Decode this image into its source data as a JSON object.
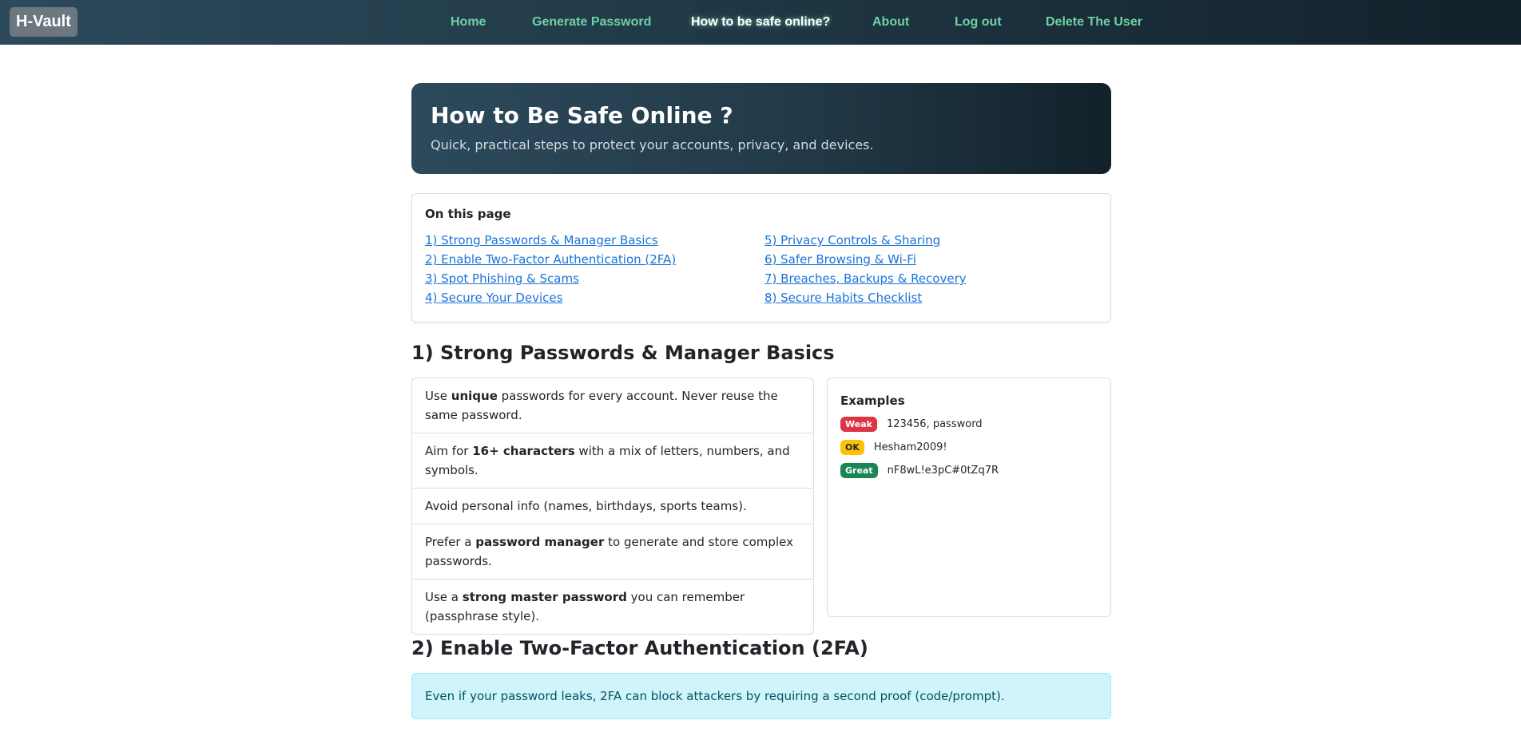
{
  "navbar": {
    "brand": "H-Vault",
    "links": [
      {
        "label": "Home"
      },
      {
        "label": "Generate Password"
      },
      {
        "label": "How to be safe online?",
        "active": true
      },
      {
        "label": "About"
      },
      {
        "label": "Log out"
      },
      {
        "label": "Delete The User"
      }
    ]
  },
  "hero": {
    "title": "How to Be Safe Online ?",
    "subtitle": "Quick, practical steps to protect your accounts, privacy, and devices."
  },
  "toc": {
    "title": "On this page",
    "left": [
      "1) Strong Passwords & Manager Basics",
      "2) Enable Two-Factor Authentication (2FA)",
      "3) Spot Phishing & Scams",
      "4) Secure Your Devices"
    ],
    "right": [
      "5) Privacy Controls & Sharing",
      "6) Safer Browsing & Wi-Fi",
      "7) Breaches, Backups & Recovery",
      "8) Secure Habits Checklist"
    ]
  },
  "section1": {
    "heading": "1) Strong Passwords & Manager Basics",
    "items": [
      {
        "pre": "Use ",
        "bold": "unique",
        "post": " passwords for every account. Never reuse the same password."
      },
      {
        "pre": "Aim for ",
        "bold": "16+ characters",
        "post": " with a mix of letters, numbers, and symbols."
      },
      {
        "pre": "Avoid personal info (names, birthdays, sports teams).",
        "bold": "",
        "post": ""
      },
      {
        "pre": "Prefer a ",
        "bold": "password manager",
        "post": " to generate and store complex passwords."
      },
      {
        "pre": "Use a ",
        "bold": "strong master password",
        "post": " you can remember (passphrase style)."
      }
    ],
    "examples": {
      "title": "Examples",
      "rows": [
        {
          "badge": "Weak",
          "text": "123456, password"
        },
        {
          "badge": "OK",
          "text": "Hesham2009!"
        },
        {
          "badge": "Great",
          "text": "nF8wL!e3pC#0tZq7R"
        }
      ]
    }
  },
  "section2": {
    "heading": "2) Enable Two-Factor Authentication (2FA)",
    "alert": "Even if your password leaks, 2FA can block attackers by requiring a second proof (code/prompt)."
  },
  "colors": {
    "nav_link": "#6fd1a5",
    "link": "#1a73d9",
    "weak": "#dc3545",
    "ok": "#ffc107",
    "great": "#198754",
    "info_bg": "#cff4fc"
  }
}
